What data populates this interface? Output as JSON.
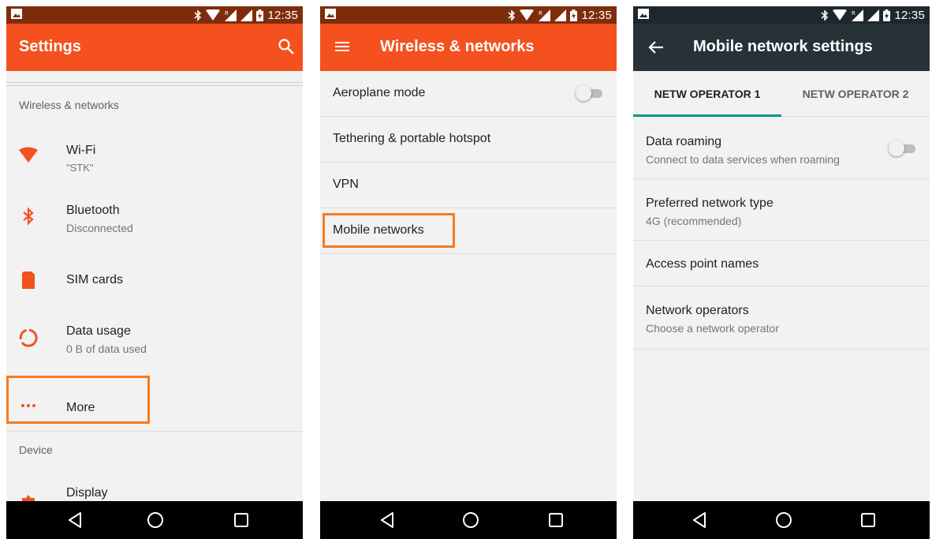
{
  "status_bar": {
    "time": "12:35"
  },
  "colors": {
    "accent": "#f4511e",
    "accent_dark": "#7e2d0c",
    "toolbar_dark": "#263238",
    "highlight": "#f47b20",
    "tab_indicator": "#009688"
  },
  "screen1": {
    "title": "Settings",
    "search_icon": "search-icon",
    "section_wireless": "Wireless & networks",
    "items": [
      {
        "icon": "wifi-icon",
        "title": "Wi-Fi",
        "subtitle": "\"STK\""
      },
      {
        "icon": "bluetooth-icon",
        "title": "Bluetooth",
        "subtitle": "Disconnected"
      },
      {
        "icon": "sim-card-icon",
        "title": "SIM cards",
        "subtitle": ""
      },
      {
        "icon": "data-usage-icon",
        "title": "Data usage",
        "subtitle": "0 B of data used"
      },
      {
        "icon": "more-dots-icon",
        "title": "More",
        "subtitle": ""
      }
    ],
    "section_device": "Device",
    "display_item": {
      "icon": "display-icon",
      "title": "Display"
    }
  },
  "screen2": {
    "title": "Wireless & networks",
    "menu_icon": "hamburger-menu-icon",
    "items": [
      {
        "title": "Aeroplane mode",
        "toggle": false
      },
      {
        "title": "Tethering & portable hotspot"
      },
      {
        "title": "VPN"
      },
      {
        "title": "Mobile networks"
      }
    ]
  },
  "screen3": {
    "title": "Mobile network settings",
    "back_icon": "back-arrow-icon",
    "tabs": [
      {
        "label": "NETW OPERATOR 1",
        "selected": true
      },
      {
        "label": "NETW OPERATOR 2",
        "selected": false
      }
    ],
    "items": [
      {
        "title": "Data roaming",
        "subtitle": "Connect to data services when roaming",
        "toggle": false
      },
      {
        "title": "Preferred network type",
        "subtitle": "4G (recommended)"
      },
      {
        "title": "Access point names",
        "subtitle": ""
      },
      {
        "title": "Network operators",
        "subtitle": "Choose a network operator"
      }
    ]
  },
  "nav_bar": {
    "back": "back-triangle-icon",
    "home": "home-circle-icon",
    "recents": "recents-square-icon"
  }
}
